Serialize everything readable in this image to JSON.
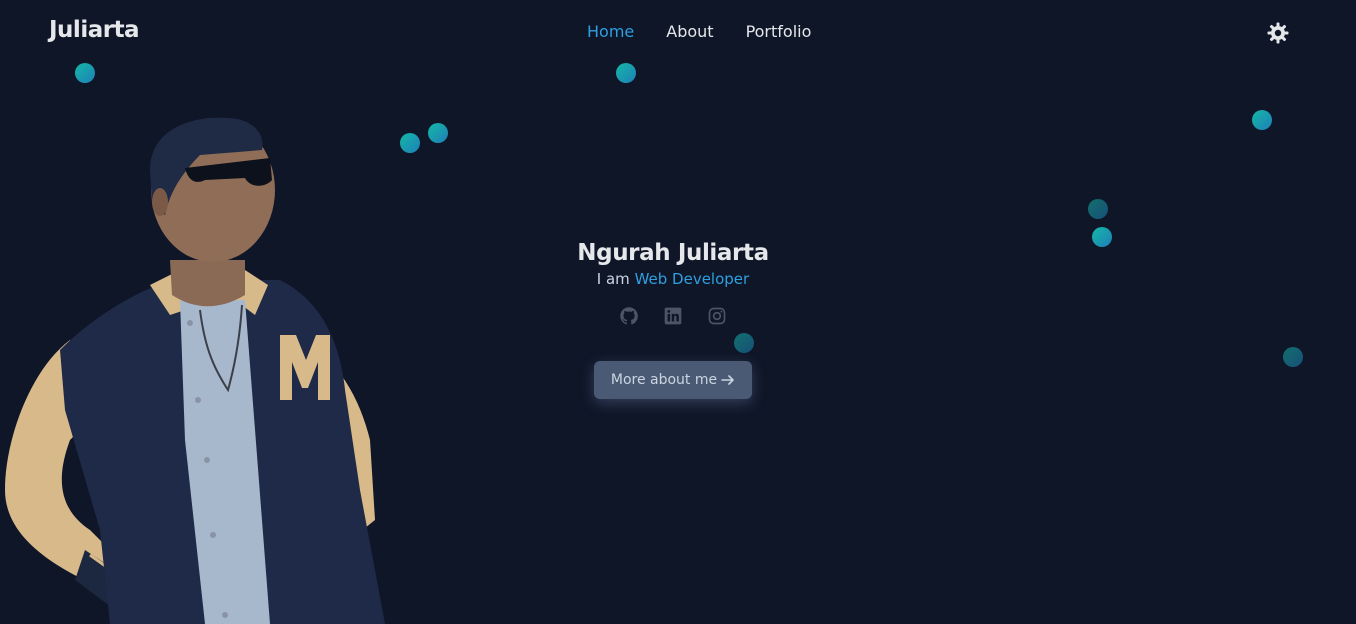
{
  "nav": {
    "brand": "Juliarta",
    "links": [
      {
        "label": "Home",
        "active": true
      },
      {
        "label": "About",
        "active": false
      },
      {
        "label": "Portfolio",
        "active": false
      }
    ],
    "theme_toggle_icon": "gear-sun-icon"
  },
  "hero": {
    "name": "Ngurah Juliarta",
    "prefix": "I am",
    "role": "Web Developer",
    "cta_label": "More about me",
    "cta_icon": "arrow-right-icon",
    "socials": [
      "github-icon",
      "linkedin-icon",
      "instagram-icon"
    ]
  },
  "colors": {
    "background": "#0f1628",
    "accent": "#2f9fe0",
    "dot_start": "#14b8a6",
    "dot_end": "#1e7fb8",
    "button": "#4b5a74"
  }
}
